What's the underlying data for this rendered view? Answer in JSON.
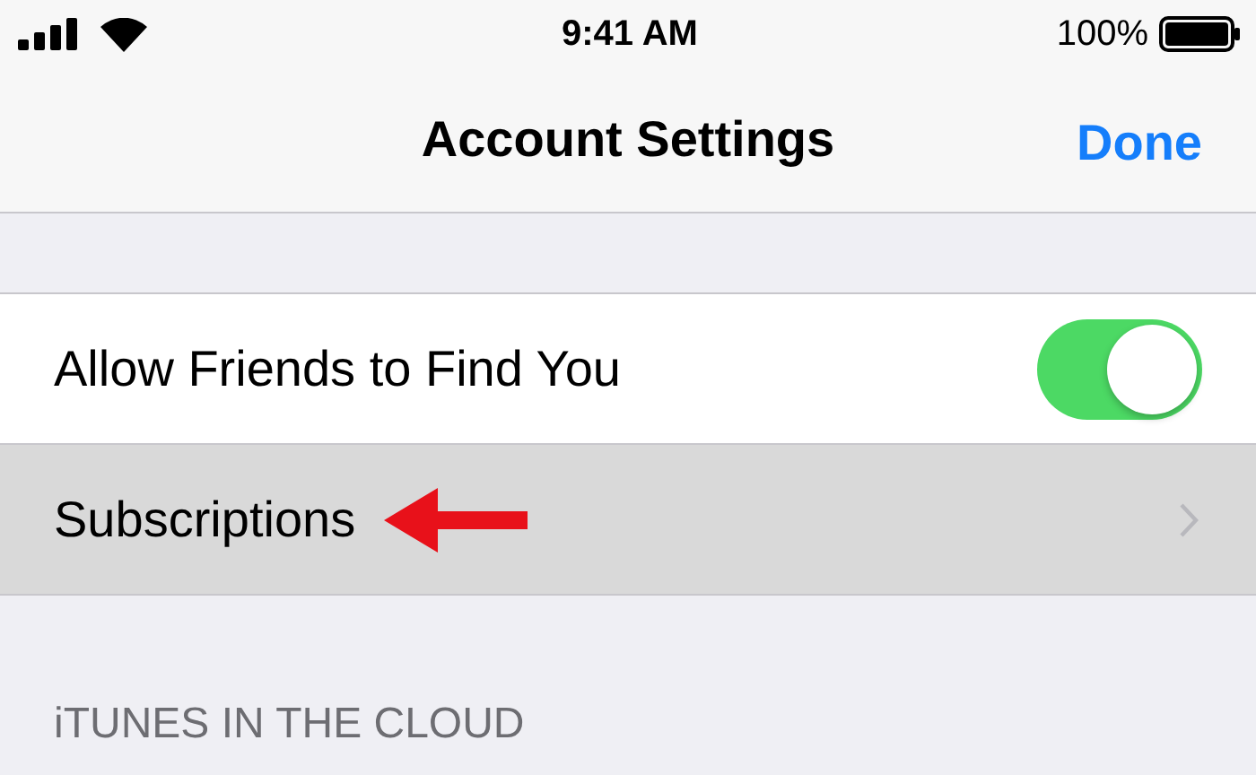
{
  "status_bar": {
    "time": "9:41 AM",
    "battery": "100%"
  },
  "nav_bar": {
    "title": "Account Settings",
    "action": "Done"
  },
  "rows": [
    {
      "kind": "toggle",
      "label": "Allow Friends to Find You",
      "on": true,
      "selected": false
    },
    {
      "kind": "link",
      "label": "Subscriptions",
      "selected": true,
      "annotated": true
    }
  ],
  "section_header": "iTUNES IN THE CLOUD"
}
